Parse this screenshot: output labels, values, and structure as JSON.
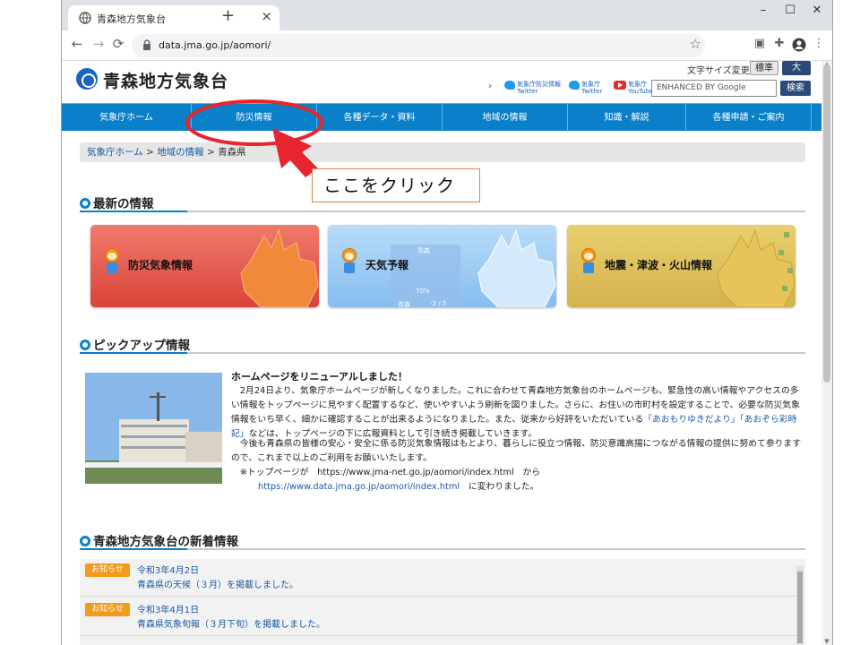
{
  "browser": {
    "tab_title": "青森地方気象台",
    "tab_close": "×",
    "new_tab": "+",
    "window_minimize": "–",
    "window_maximize": "☐",
    "window_close": "✕",
    "url": "data.jma.go.jp/aomori/",
    "menu": "⋮"
  },
  "site": {
    "title": "青森地方気象台",
    "font_size": {
      "label": "文字サイズ変更",
      "standard": "標準",
      "large": "大"
    },
    "sns": [
      {
        "line1": "気象庁防災情報",
        "line2": "Twitter"
      },
      {
        "line1": "気象庁",
        "line2": "Twitter"
      },
      {
        "line1": "気象庁",
        "line2": "YouTube"
      }
    ],
    "search": {
      "placeholder": "ENHANCED BY Google",
      "button": "検索"
    }
  },
  "global_nav": [
    "気象庁ホーム",
    "防災情報",
    "各種データ・資料",
    "地域の情報",
    "知識・解説",
    "各種申請・ご案内"
  ],
  "breadcrumb": {
    "home": "気象庁ホーム",
    "sep": ">",
    "region": "地域の情報",
    "current": "青森県"
  },
  "sections": {
    "latest": "最新の情報",
    "pickup": "ピックアップ情報",
    "news": "青森地方気象台の新着情報"
  },
  "cards": [
    {
      "label": "防災気象情報",
      "color": "#e85a4f"
    },
    {
      "label": "天気予報",
      "color": "#8cc0f0",
      "inner_place": "青森",
      "inner_pct": "70%",
      "inner_temp": "-2 / 5",
      "inner_city": "青森"
    },
    {
      "label": "地震・津波・火山情報",
      "color": "#e0c060"
    }
  ],
  "pickup": {
    "heading": "ホームページをリニューアルしました！",
    "p1": "　2月24日より、気象庁ホームページが新しくなりました。これに合わせて青森地方気象台のホームページも、緊急性の高い情報やアクセスの多い情報をトップページに見やすく配置するなど、使いやすいよう刷新を図りました。さらに、お住いの市町村を設定することで、必要な防災気象情報をいち早く、細かに確認することが出来るようになりました。また、従来から好評をいただいている",
    "p1_link1": "「あおもりゆきだより」",
    "p1_link2": "「あおぞら彩時記」",
    "p1_tail": "などは、トップページの下に広報資料として引き続き掲載していきます。",
    "p2": "　今後も青森県の皆様の安心・安全に係る防災気象情報はもとより、暮らしに役立つ情報、防災意識高揚につながる情報の提供に努めて参りますので、これまで以上のご利用をお願いいたします。",
    "p3_prefix": "　※トップページが　https://www.jma-net.go.jp/aomori/index.html　から",
    "p3_link": "https://www.data.jma.go.jp/aomori/index.html",
    "p3_suffix": "　に変わりました。"
  },
  "news_items": [
    {
      "badge": "お知らせ",
      "date": "令和3年4月2日",
      "text": "青森県の天候（３月）を掲載しました。"
    },
    {
      "badge": "お知らせ",
      "date": "令和3年4月1日",
      "text": "青森県気象旬報（３月下旬）を掲載しました。"
    }
  ],
  "annotation": {
    "callout": "ここをクリック",
    "color": "#e8242c"
  }
}
